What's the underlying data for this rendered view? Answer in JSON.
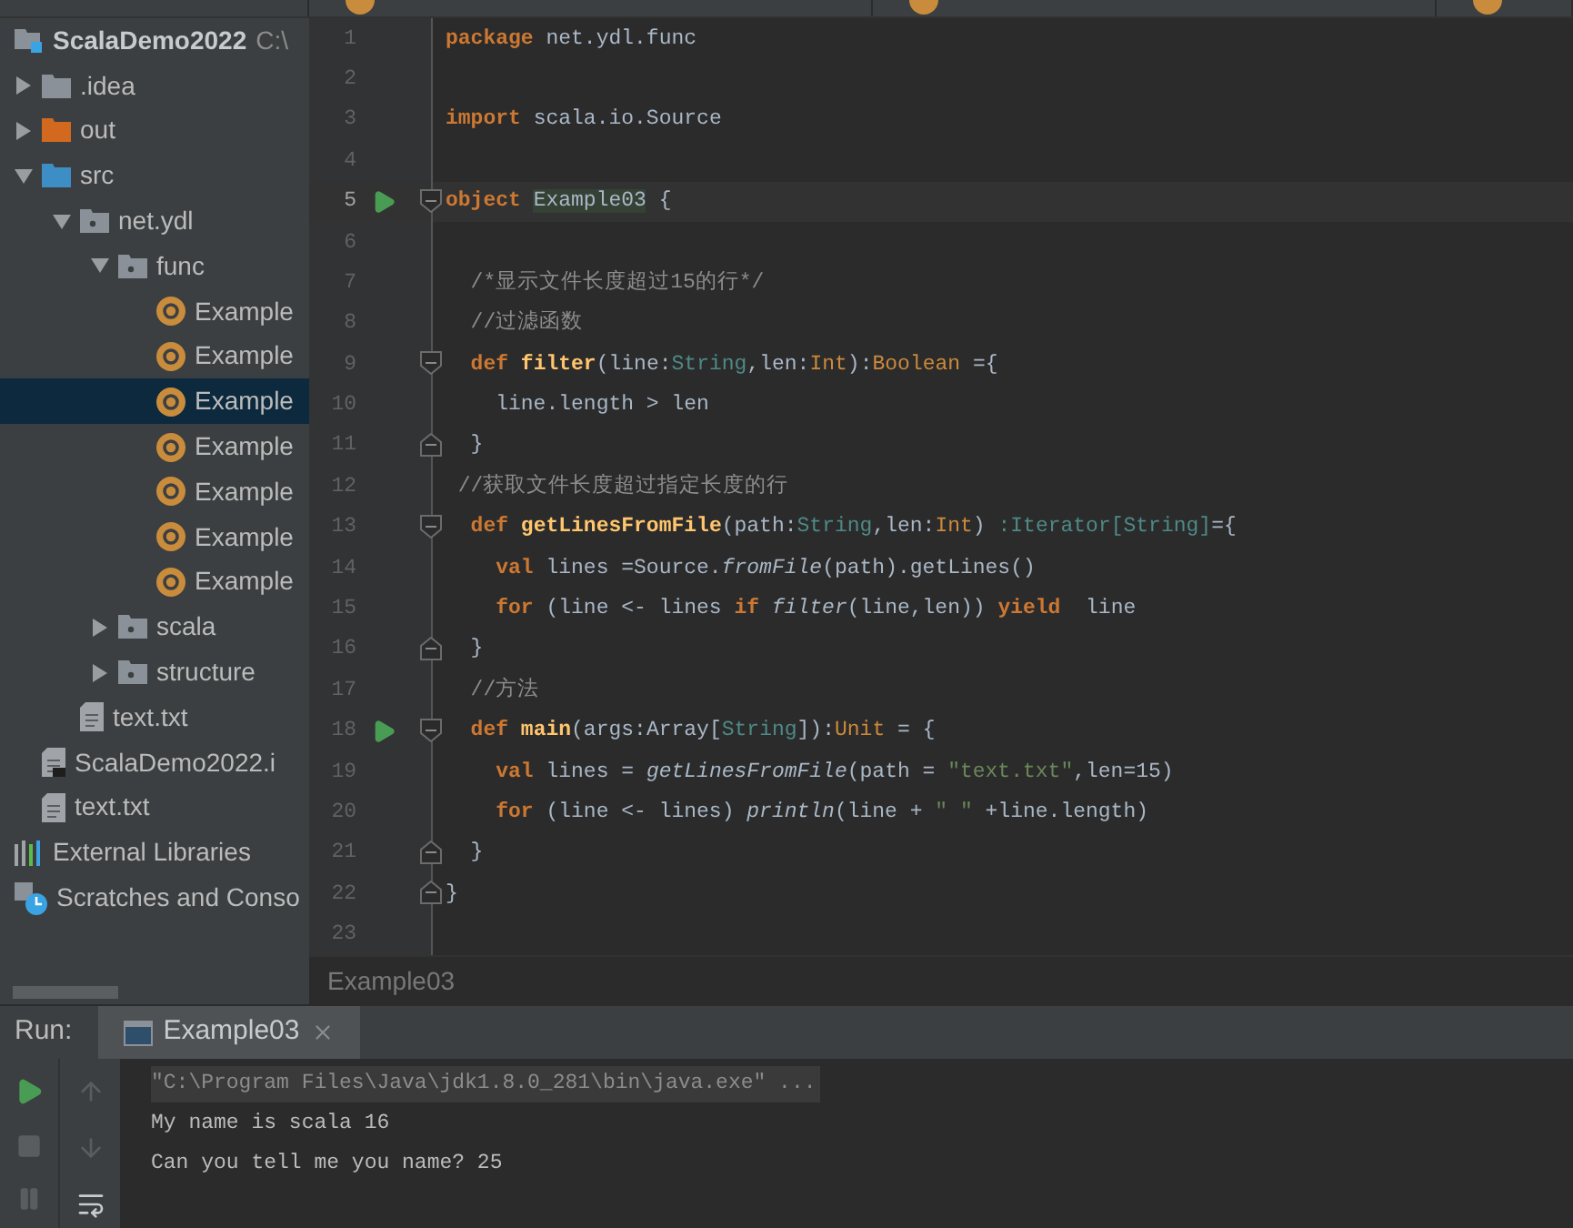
{
  "project_tree": [
    {
      "label": "ScalaDemo2022",
      "path": "C:\\",
      "kind": "project",
      "selected": false,
      "children": [
        {
          "label": ".idea",
          "kind": "folder",
          "expanded": false,
          "selected": false
        },
        {
          "label": "out",
          "kind": "excluded-folder",
          "expanded": false,
          "selected": false
        },
        {
          "label": "src",
          "kind": "source-folder",
          "expanded": true,
          "selected": false,
          "children": [
            {
              "label": "net.ydl",
              "kind": "package",
              "expanded": true,
              "selected": false,
              "children": [
                {
                  "label": "func",
                  "kind": "package",
                  "expanded": true,
                  "selected": false,
                  "children": [
                    {
                      "label": "Example",
                      "kind": "scala-object",
                      "selected": false
                    },
                    {
                      "label": "Example",
                      "kind": "scala-object",
                      "selected": false
                    },
                    {
                      "label": "Example",
                      "kind": "scala-object",
                      "selected": true
                    },
                    {
                      "label": "Example",
                      "kind": "scala-object",
                      "selected": false
                    },
                    {
                      "label": "Example",
                      "kind": "scala-object",
                      "selected": false
                    },
                    {
                      "label": "Example",
                      "kind": "scala-object",
                      "selected": false
                    },
                    {
                      "label": "Example",
                      "kind": "scala-object",
                      "selected": false
                    }
                  ]
                },
                {
                  "label": "scala",
                  "kind": "package",
                  "expanded": false,
                  "selected": false
                },
                {
                  "label": "structure",
                  "kind": "package",
                  "expanded": false,
                  "selected": false
                }
              ]
            },
            {
              "label": "text.txt",
              "kind": "text-file",
              "selected": false
            }
          ]
        },
        {
          "label": "ScalaDemo2022.i",
          "kind": "module-file",
          "selected": false
        },
        {
          "label": "text.txt",
          "kind": "text-file",
          "selected": false
        }
      ]
    },
    {
      "label": "External Libraries",
      "kind": "libraries",
      "selected": false
    },
    {
      "label": "Scratches and Conso",
      "kind": "scratches",
      "selected": false
    }
  ],
  "editor": {
    "lines": [
      {
        "number": "1",
        "tokens": [
          {
            "kind": "keyword",
            "text": "package"
          },
          {
            "kind": "plain",
            "text": " net.ydl.func"
          }
        ]
      },
      {
        "number": "2"
      },
      {
        "number": "3",
        "tokens": [
          {
            "kind": "keyword",
            "text": "import"
          },
          {
            "kind": "plain",
            "text": " scala.io.Source"
          }
        ]
      },
      {
        "number": "4"
      },
      {
        "number": "5",
        "current": true,
        "run": true,
        "fold_open": true,
        "tokens": [
          {
            "kind": "keyword",
            "text": "object "
          },
          {
            "kind": "highlight",
            "text": "Example03"
          },
          {
            "kind": "plain",
            "text": " {"
          }
        ]
      },
      {
        "number": "6"
      },
      {
        "number": "7",
        "tokens": [
          {
            "kind": "comment",
            "text": "  /*显示文件长度超过15的行*/"
          }
        ]
      },
      {
        "number": "8",
        "tokens": [
          {
            "kind": "comment",
            "text": "  //过滤函数"
          }
        ]
      },
      {
        "number": "9",
        "fold_open": true,
        "tokens": [
          {
            "kind": "keyword",
            "text": "  def "
          },
          {
            "kind": "function",
            "text": "filter"
          },
          {
            "kind": "plain",
            "text": "(line:"
          },
          {
            "kind": "type",
            "text": "String"
          },
          {
            "kind": "plain",
            "text": ",len:"
          },
          {
            "kind": "class",
            "text": "Int"
          },
          {
            "kind": "plain",
            "text": "):"
          },
          {
            "kind": "class",
            "text": "Boolean"
          },
          {
            "kind": "plain",
            "text": " ={"
          }
        ]
      },
      {
        "number": "10",
        "tokens": [
          {
            "kind": "plain",
            "text": "    line.length > len"
          }
        ]
      },
      {
        "number": "11",
        "fold_close": true,
        "tokens": [
          {
            "kind": "plain",
            "text": "  }"
          }
        ]
      },
      {
        "number": "12",
        "tokens": [
          {
            "kind": "comment",
            "text": " //获取文件长度超过指定长度的行"
          }
        ]
      },
      {
        "number": "13",
        "fold_open": true,
        "tokens": [
          {
            "kind": "keyword",
            "text": "  def "
          },
          {
            "kind": "function",
            "text": "getLinesFromFile"
          },
          {
            "kind": "plain",
            "text": "(path:"
          },
          {
            "kind": "type",
            "text": "String"
          },
          {
            "kind": "plain",
            "text": ",len:"
          },
          {
            "kind": "class",
            "text": "Int"
          },
          {
            "kind": "plain",
            "text": ") "
          },
          {
            "kind": "type",
            "text": ":Iterator[String]"
          },
          {
            "kind": "plain",
            "text": "={"
          }
        ]
      },
      {
        "number": "14",
        "tokens": [
          {
            "kind": "keyword",
            "text": "    val"
          },
          {
            "kind": "plain",
            "text": " lines =Source."
          },
          {
            "kind": "call",
            "text": "fromFile"
          },
          {
            "kind": "plain",
            "text": "(path).getLines()"
          }
        ]
      },
      {
        "number": "15",
        "tokens": [
          {
            "kind": "keyword",
            "text": "    for"
          },
          {
            "kind": "plain",
            "text": " (line <- lines "
          },
          {
            "kind": "keyword",
            "text": "if "
          },
          {
            "kind": "call",
            "text": "filter"
          },
          {
            "kind": "plain",
            "text": "(line,len)) "
          },
          {
            "kind": "keyword",
            "text": "yield"
          },
          {
            "kind": "plain",
            "text": "  line"
          }
        ]
      },
      {
        "number": "16",
        "fold_close": true,
        "tokens": [
          {
            "kind": "plain",
            "text": "  }"
          }
        ]
      },
      {
        "number": "17",
        "tokens": [
          {
            "kind": "comment",
            "text": "  //方法"
          }
        ]
      },
      {
        "number": "18",
        "run": true,
        "fold_open": true,
        "tokens": [
          {
            "kind": "keyword",
            "text": "  def "
          },
          {
            "kind": "function",
            "text": "main"
          },
          {
            "kind": "plain",
            "text": "(args:Array["
          },
          {
            "kind": "type",
            "text": "String"
          },
          {
            "kind": "plain",
            "text": "]):"
          },
          {
            "kind": "class",
            "text": "Unit"
          },
          {
            "kind": "plain",
            "text": " = {"
          }
        ]
      },
      {
        "number": "19",
        "tokens": [
          {
            "kind": "keyword",
            "text": "    val"
          },
          {
            "kind": "plain",
            "text": " lines = "
          },
          {
            "kind": "call",
            "text": "getLinesFromFile"
          },
          {
            "kind": "plain",
            "text": "(path = "
          },
          {
            "kind": "string",
            "text": "\"text.txt\""
          },
          {
            "kind": "plain",
            "text": ",len=15)"
          }
        ]
      },
      {
        "number": "20",
        "tokens": [
          {
            "kind": "keyword",
            "text": "    for"
          },
          {
            "kind": "plain",
            "text": " (line <- lines) "
          },
          {
            "kind": "call",
            "text": "println"
          },
          {
            "kind": "plain",
            "text": "(line + "
          },
          {
            "kind": "string",
            "text": "\" \""
          },
          {
            "kind": "plain",
            "text": " +line.length)"
          }
        ]
      },
      {
        "number": "21",
        "fold_close": true,
        "tokens": [
          {
            "kind": "plain",
            "text": "  }"
          }
        ]
      },
      {
        "number": "22",
        "fold_close": true,
        "tokens": [
          {
            "kind": "plain",
            "text": "}"
          }
        ]
      },
      {
        "number": "23"
      }
    ],
    "breadcrumb": "Example03"
  },
  "run_panel": {
    "label": "Run:",
    "tab": "Example03",
    "console": [
      {
        "kind": "command",
        "text": "\"C:\\Program Files\\Java\\jdk1.8.0_281\\bin\\java.exe\" ..."
      },
      {
        "kind": "output",
        "text": "My name is scala 16"
      },
      {
        "kind": "output",
        "text": "Can you tell me you name? 25"
      }
    ]
  }
}
